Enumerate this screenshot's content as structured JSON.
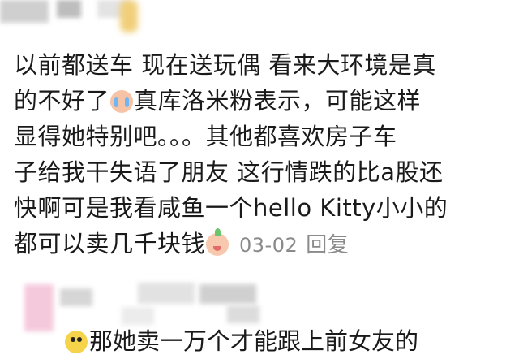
{
  "comment": {
    "line1": "以前都送车 现在送玩偶 看来大环境是真",
    "line2a": "的不好了",
    "line2b": "真库洛米粉表示，可能这样",
    "line3": "显得她特别吧。。。其他都喜欢房子车",
    "line4": "子给我干失语了朋友 这行情跌的比a股还",
    "line5": "快啊可是我看咸鱼一个hello Kitty小小的",
    "line6": "都可以卖几千块钱",
    "date": "03-02",
    "reply_label": "回复"
  },
  "reply_preview": {
    "text": "那她卖一万个才能跟上前女友的"
  },
  "icons": {
    "emoji_1": "crying-face-emoji",
    "emoji_2": "peach-face-emoji",
    "emoji_3": "chick-emoji"
  }
}
